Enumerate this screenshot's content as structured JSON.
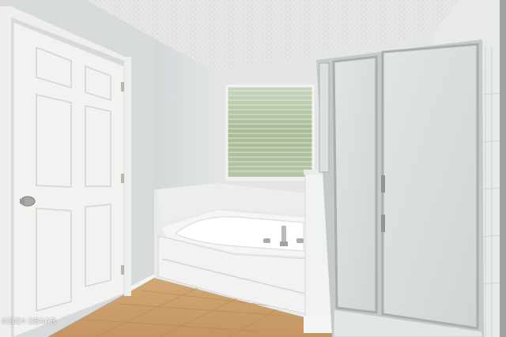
{
  "photo": {
    "subject": "bathroom",
    "watermark": "©2024 DBAAR"
  },
  "colors": {
    "ceiling": "#e7e8e6",
    "wall": "#dfe2e3",
    "door": "#f3f3f1",
    "tile_floor": "#cfa36f",
    "shower_glass": "#d8dcdc",
    "shower_frame": "#b9bdbe"
  }
}
